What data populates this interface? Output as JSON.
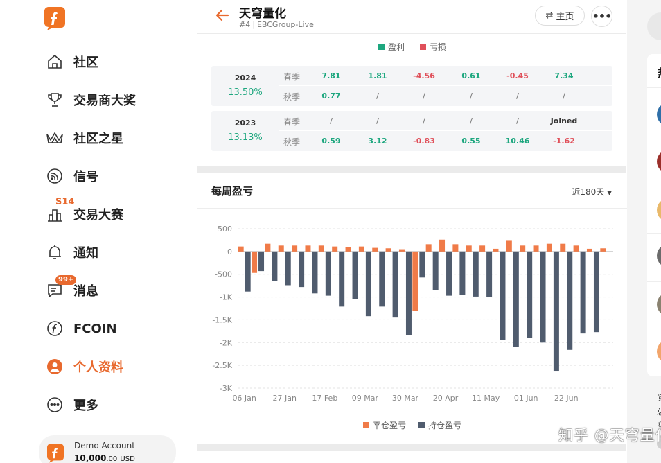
{
  "sidebar": {
    "items": [
      {
        "label": "社区",
        "icon": "home-icon"
      },
      {
        "label": "交易商大奖",
        "icon": "trophy-icon"
      },
      {
        "label": "社区之星",
        "icon": "crown-icon"
      },
      {
        "label": "信号",
        "icon": "signal-icon"
      },
      {
        "label": "交易大赛",
        "icon": "contest-icon",
        "badge": "S14"
      },
      {
        "label": "通知",
        "icon": "bell-icon"
      },
      {
        "label": "消息",
        "icon": "message-icon",
        "badge": "99+"
      },
      {
        "label": "FCOIN",
        "icon": "fcoin-icon"
      },
      {
        "label": "个人资料",
        "icon": "user-icon",
        "active": true
      },
      {
        "label": "更多",
        "icon": "more-icon"
      }
    ],
    "account": {
      "name": "Demo Account",
      "balance": "10,000",
      "balance_decimals": ".00",
      "currency": "USD"
    }
  },
  "header": {
    "title": "天穹量化",
    "rank": "#4",
    "server": "EBCGroup-Live",
    "home_label": "主页",
    "more_label": "•••"
  },
  "monthly": {
    "legend_profit": "盈利",
    "legend_loss": "亏损",
    "colors": {
      "profit": "#1ea77f",
      "loss": "#e0505a"
    },
    "years": [
      {
        "year": "2024",
        "total": "13.50%",
        "rows": [
          {
            "season": "春季",
            "values": [
              "7.81",
              "1.81",
              "-4.56",
              "0.61",
              "-0.45",
              "7.34"
            ]
          },
          {
            "season": "秋季",
            "values": [
              "0.77",
              "/",
              "/",
              "/",
              "/",
              "/"
            ]
          }
        ]
      },
      {
        "year": "2023",
        "total": "13.13%",
        "rows": [
          {
            "season": "春季",
            "values": [
              "/",
              "/",
              "/",
              "/",
              "/",
              "Joined"
            ]
          },
          {
            "season": "秋季",
            "values": [
              "0.59",
              "3.12",
              "-0.83",
              "0.55",
              "10.46",
              "-1.62"
            ]
          }
        ]
      }
    ]
  },
  "weekly": {
    "title": "每周盈亏",
    "range_label": "近180天",
    "legend_closed": "平仓盈亏",
    "legend_floating": "持仓盈亏"
  },
  "chart_data": {
    "type": "bar",
    "title": "每周盈亏",
    "xlabel": "",
    "ylabel": "",
    "ylim": [
      -3000,
      500
    ],
    "yticks": [
      500,
      0,
      -500,
      -1000,
      -1500,
      -2000,
      -2500,
      -3000
    ],
    "ytick_labels": [
      "500",
      "0",
      "-500",
      "-1K",
      "-1.5K",
      "-2K",
      "-2.5K",
      "-3K"
    ],
    "x_tick_labels": [
      "06 Jan",
      "27 Jan",
      "17 Feb",
      "09 Mar",
      "30 Mar",
      "20 Apr",
      "11 May",
      "01 Jun",
      "22 Jun"
    ],
    "x_tick_index": [
      0,
      3,
      6,
      9,
      12,
      15,
      18,
      21,
      24
    ],
    "grid": true,
    "legend_position": "bottom",
    "colors": {
      "closed": "#f07b48",
      "floating": "#505c6e",
      "closed_negative": "#f07b48"
    },
    "series": [
      {
        "name": "平仓盈亏",
        "values": [
          110,
          -470,
          170,
          130,
          130,
          130,
          130,
          110,
          90,
          110,
          80,
          70,
          50,
          -1310,
          160,
          260,
          160,
          130,
          130,
          60,
          250,
          130,
          130,
          170,
          170,
          130,
          60,
          70
        ]
      },
      {
        "name": "持仓盈亏",
        "values": [
          -880,
          -430,
          -650,
          -740,
          -780,
          -920,
          -970,
          -1210,
          -1050,
          -1420,
          -1210,
          -1450,
          -1840,
          -570,
          -840,
          -970,
          -960,
          -990,
          -1000,
          -1950,
          -2100,
          -1900,
          -2000,
          -2620,
          -2160,
          -1800,
          -1770,
          0
        ]
      }
    ]
  },
  "right_panel": {
    "heading": "热",
    "snippets": [
      "阅",
      "总",
      "©"
    ]
  },
  "watermark": "知乎 @天穹量化"
}
